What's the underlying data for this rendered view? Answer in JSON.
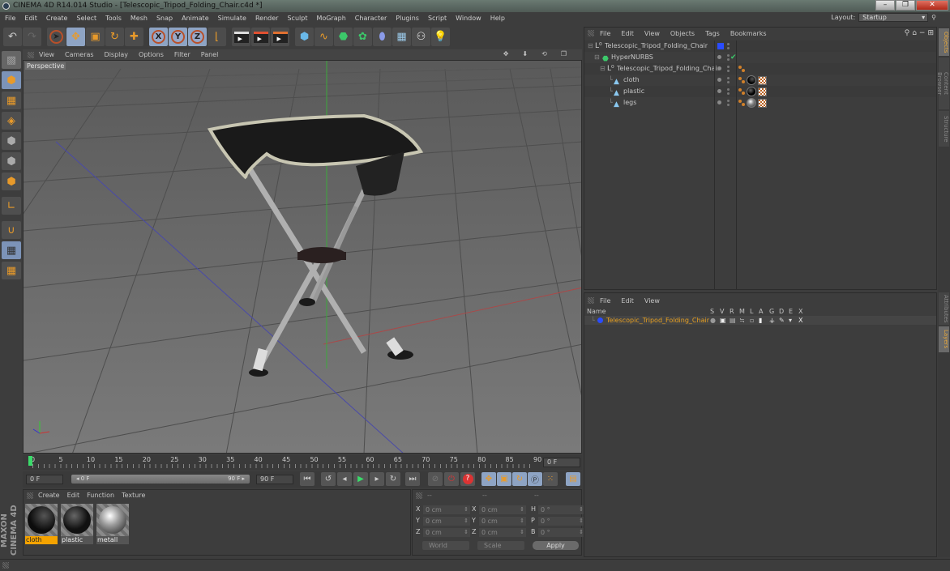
{
  "window": {
    "title": "CINEMA 4D R14.014 Studio - [Telescopic_Tripod_Folding_Chair.c4d *]",
    "minimize": "–",
    "maximize": "❐",
    "close": "✕"
  },
  "menubar": [
    "File",
    "Edit",
    "Create",
    "Select",
    "Tools",
    "Mesh",
    "Snap",
    "Animate",
    "Simulate",
    "Render",
    "Sculpt",
    "MoGraph",
    "Character",
    "Plugins",
    "Script",
    "Window",
    "Help"
  ],
  "layout": {
    "label": "Layout:",
    "value": "Startup"
  },
  "toolbar": {
    "undo": "↶",
    "redo": "↷",
    "axis_x": "X",
    "axis_y": "Y",
    "axis_z": "Z"
  },
  "viewport": {
    "menu": [
      "View",
      "Cameras",
      "Display",
      "Options",
      "Filter",
      "Panel"
    ],
    "camera_label": "Perspective",
    "nav_icons": [
      "✥",
      "⬇",
      "⟲",
      "❐"
    ]
  },
  "timeline": {
    "ticks": [
      "0",
      "5",
      "10",
      "15",
      "20",
      "25",
      "30",
      "35",
      "40",
      "45",
      "50",
      "55",
      "60",
      "65",
      "70",
      "75",
      "80",
      "85",
      "90"
    ],
    "current_frame": "0 F"
  },
  "transport": {
    "start_field": "0 F",
    "range_start": "◂ 0 F",
    "range_end": "90 F ▸",
    "end_field": "90 F"
  },
  "materials": {
    "menu": [
      "Create",
      "Edit",
      "Function",
      "Texture"
    ],
    "items": [
      {
        "name": "cloth",
        "selected": true
      },
      {
        "name": "plastic",
        "selected": false
      },
      {
        "name": "metall",
        "selected": false
      }
    ]
  },
  "branding": "MAXON CINEMA 4D",
  "coordinates": {
    "headers": [
      "--",
      "--",
      "--"
    ],
    "rows": [
      {
        "pos_label": "X",
        "pos": "0 cm",
        "size_label": "X",
        "size": "0 cm",
        "rot_label": "H",
        "rot": "0 °"
      },
      {
        "pos_label": "Y",
        "pos": "0 cm",
        "size_label": "Y",
        "size": "0 cm",
        "rot_label": "P",
        "rot": "0 °"
      },
      {
        "pos_label": "Z",
        "pos": "0 cm",
        "size_label": "Z",
        "size": "0 cm",
        "rot_label": "B",
        "rot": "0 °"
      }
    ],
    "space": "World",
    "mode": "Scale",
    "apply": "Apply"
  },
  "object_manager": {
    "menu": [
      "File",
      "Edit",
      "View",
      "Objects",
      "Tags",
      "Bookmarks"
    ],
    "objects": [
      {
        "name": "Telescopic_Tripod_Folding_Chair",
        "type": "null",
        "level": 0
      },
      {
        "name": "HyperNURBS",
        "type": "hypernurbs",
        "level": 1
      },
      {
        "name": "Telescopic_Tripod_Folding_Chair",
        "type": "null",
        "level": 2
      },
      {
        "name": "cloth",
        "type": "polygon",
        "level": 3
      },
      {
        "name": "plastic",
        "type": "polygon",
        "level": 3
      },
      {
        "name": "legs",
        "type": "polygon",
        "level": 3
      }
    ]
  },
  "layer_manager": {
    "menu": [
      "File",
      "Edit",
      "View"
    ],
    "columns": [
      "Name",
      "S",
      "V",
      "R",
      "M",
      "L",
      "A",
      "G",
      "D",
      "E",
      "X"
    ],
    "layers": [
      {
        "name": "Telescopic_Tripod_Folding_Chair",
        "color": "#2a4cff"
      }
    ]
  },
  "side_tabs": {
    "top": [
      "Objects",
      "Content Browser",
      "Structure"
    ],
    "bottom": [
      "Attributes",
      "Layers"
    ]
  },
  "colors": {
    "accent_orange": "#f5a300",
    "layer_name": "#e8a020",
    "selection_blue": "#8ea4c4"
  }
}
